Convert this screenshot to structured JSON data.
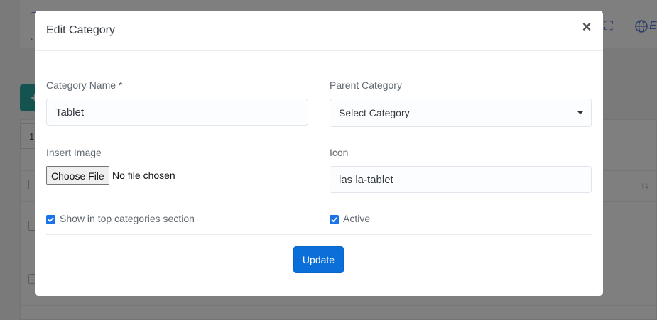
{
  "background": {
    "language_partial": "E",
    "add_button_partial": "+",
    "pagination_partial": "1",
    "sort_glyph": "↑↓"
  },
  "modal": {
    "title": "Edit Category",
    "close_glyph": "×",
    "fields": {
      "category_name": {
        "label": "Category Name *",
        "value": "Tablet"
      },
      "parent_category": {
        "label": "Parent Category",
        "selected": "Select Category"
      },
      "insert_image": {
        "label": "Insert Image",
        "button_label": "Choose File",
        "status": "No file chosen"
      },
      "icon": {
        "label": "Icon",
        "value": "las la-tablet"
      }
    },
    "checkboxes": {
      "top_categories": {
        "label": "Show in top categories section",
        "checked": true
      },
      "active": {
        "label": "Active",
        "checked": true
      }
    },
    "submit_label": "Update"
  },
  "colors": {
    "accent": "#0b6fd9",
    "checkbox": "#1a73e8",
    "overlay": "rgba(0,0,0,0.5)"
  }
}
